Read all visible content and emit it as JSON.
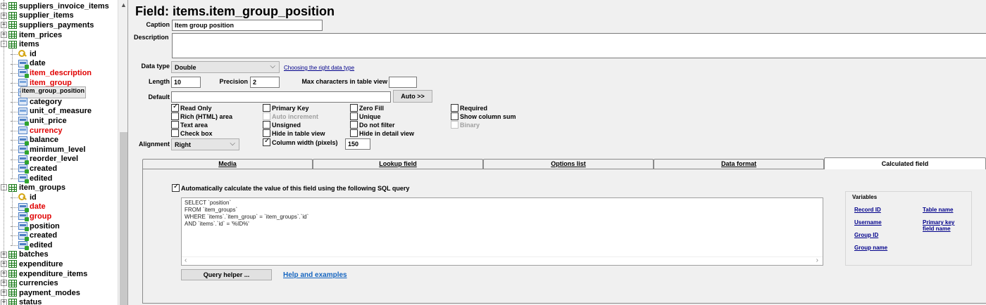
{
  "tree": {
    "rows": [
      {
        "label": "suppliers_invoice_items",
        "kind": "table",
        "level": 0,
        "expander": "+",
        "red": false
      },
      {
        "label": "supplier_items",
        "kind": "table",
        "level": 0,
        "expander": "+",
        "red": false
      },
      {
        "label": "suppliers_payments",
        "kind": "table",
        "level": 0,
        "expander": "+",
        "red": false
      },
      {
        "label": "item_prices",
        "kind": "table",
        "level": 0,
        "expander": "+",
        "red": false
      },
      {
        "label": "items",
        "kind": "table",
        "level": 0,
        "expander": "-",
        "red": false
      },
      {
        "label": "id",
        "kind": "key",
        "level": 1,
        "red": false
      },
      {
        "label": "date",
        "kind": "field",
        "level": 1,
        "red": false
      },
      {
        "label": "item_description",
        "kind": "field",
        "level": 1,
        "red": true
      },
      {
        "label": "item_group",
        "kind": "fieldplain",
        "level": 1,
        "red": true
      },
      {
        "label": "item_group_position",
        "kind": "field",
        "level": 1,
        "red": false,
        "selected": true
      },
      {
        "label": "category",
        "kind": "fieldplain",
        "level": 1,
        "red": false
      },
      {
        "label": "unit_of_measure",
        "kind": "fieldplain",
        "level": 1,
        "red": false
      },
      {
        "label": "unit_price",
        "kind": "field",
        "level": 1,
        "red": false
      },
      {
        "label": "currency",
        "kind": "fieldplain",
        "level": 1,
        "red": true
      },
      {
        "label": "balance",
        "kind": "field",
        "level": 1,
        "red": false
      },
      {
        "label": "minimum_level",
        "kind": "field",
        "level": 1,
        "red": false
      },
      {
        "label": "reorder_level",
        "kind": "field",
        "level": 1,
        "red": false
      },
      {
        "label": "created",
        "kind": "field",
        "level": 1,
        "red": false
      },
      {
        "label": "edited",
        "kind": "field",
        "level": 1,
        "red": false
      },
      {
        "label": "item_groups",
        "kind": "table",
        "level": 0,
        "expander": "-",
        "red": false
      },
      {
        "label": "id",
        "kind": "key",
        "level": 1,
        "red": false
      },
      {
        "label": "date",
        "kind": "field",
        "level": 1,
        "red": true
      },
      {
        "label": "group",
        "kind": "field",
        "level": 1,
        "red": true
      },
      {
        "label": "position",
        "kind": "field",
        "level": 1,
        "red": false
      },
      {
        "label": "created",
        "kind": "field",
        "level": 1,
        "red": false
      },
      {
        "label": "edited",
        "kind": "field",
        "level": 1,
        "red": false
      },
      {
        "label": "batches",
        "kind": "table",
        "level": 0,
        "expander": "+",
        "red": false
      },
      {
        "label": "expenditure",
        "kind": "table",
        "level": 0,
        "expander": "+",
        "red": false
      },
      {
        "label": "expenditure_items",
        "kind": "table",
        "level": 0,
        "expander": "+",
        "red": false
      },
      {
        "label": "currencies",
        "kind": "table",
        "level": 0,
        "expander": "+",
        "red": false
      },
      {
        "label": "payment_modes",
        "kind": "table",
        "level": 0,
        "expander": "+",
        "red": false
      },
      {
        "label": "status",
        "kind": "table",
        "level": 0,
        "expander": "+",
        "red": false
      }
    ]
  },
  "field": {
    "title": "Field: items.item_group_position",
    "caption_label": "Caption",
    "caption_value": "Item group position",
    "description_label": "Description",
    "description_value": "",
    "datatype_label": "Data type",
    "datatype_value": "Double",
    "datatype_help": "Choosing the right data type",
    "length_label": "Length",
    "length_value": "10",
    "precision_label": "Precision",
    "precision_value": "2",
    "maxchars_label": "Max characters in table view",
    "maxchars_value": "",
    "default_label": "Default",
    "default_value": "",
    "auto_button": "Auto >>",
    "alignment_label": "Alignment",
    "alignment_value": "Right",
    "column_width_value": "150"
  },
  "options": {
    "read_only": {
      "label": "Read Only",
      "checked": true
    },
    "rich_html": {
      "label": "Rich (HTML) area",
      "checked": false
    },
    "text_area": {
      "label": "Text area",
      "checked": false
    },
    "check_box": {
      "label": "Check box",
      "checked": false
    },
    "primary_key": {
      "label": "Primary Key",
      "checked": false
    },
    "auto_increment": {
      "label": "Auto increment",
      "checked": false
    },
    "unsigned": {
      "label": "Unsigned",
      "checked": false
    },
    "hide_table": {
      "label": "Hide in table view",
      "checked": false
    },
    "column_width": {
      "label": "Column width (pixels)",
      "checked": true
    },
    "zero_fill": {
      "label": "Zero Fill",
      "checked": false
    },
    "unique": {
      "label": "Unique",
      "checked": false
    },
    "do_not_filter": {
      "label": "Do not filter",
      "checked": false
    },
    "hide_detail": {
      "label": "Hide in detail view",
      "checked": false
    },
    "required": {
      "label": "Required",
      "checked": false
    },
    "show_sum": {
      "label": "Show column sum",
      "checked": false
    },
    "binary": {
      "label": "Binary",
      "checked": false
    }
  },
  "tabs": {
    "media": "Media",
    "lookup": "Lookup field",
    "options": "Options list",
    "format": "Data format",
    "calculated": "Calculated field"
  },
  "calc": {
    "auto_label": "Automatically calculate the value of this field using the following SQL query",
    "auto_checked": true,
    "sql": [
      "SELECT `position`",
      "FROM `item_groups`",
      "WHERE `items`.`item_group` = `item_groups`.`id`",
      "AND `items`.`id` = '%ID%'"
    ],
    "query_helper": "Query helper ...",
    "help_link": "Help and examples",
    "variables_title": "Variables",
    "vars": {
      "record_id": "Record ID",
      "table_name": "Table name",
      "username": "Username",
      "pk_field": "Primary key field name",
      "group_id": "Group ID",
      "group_name": "Group name"
    }
  }
}
